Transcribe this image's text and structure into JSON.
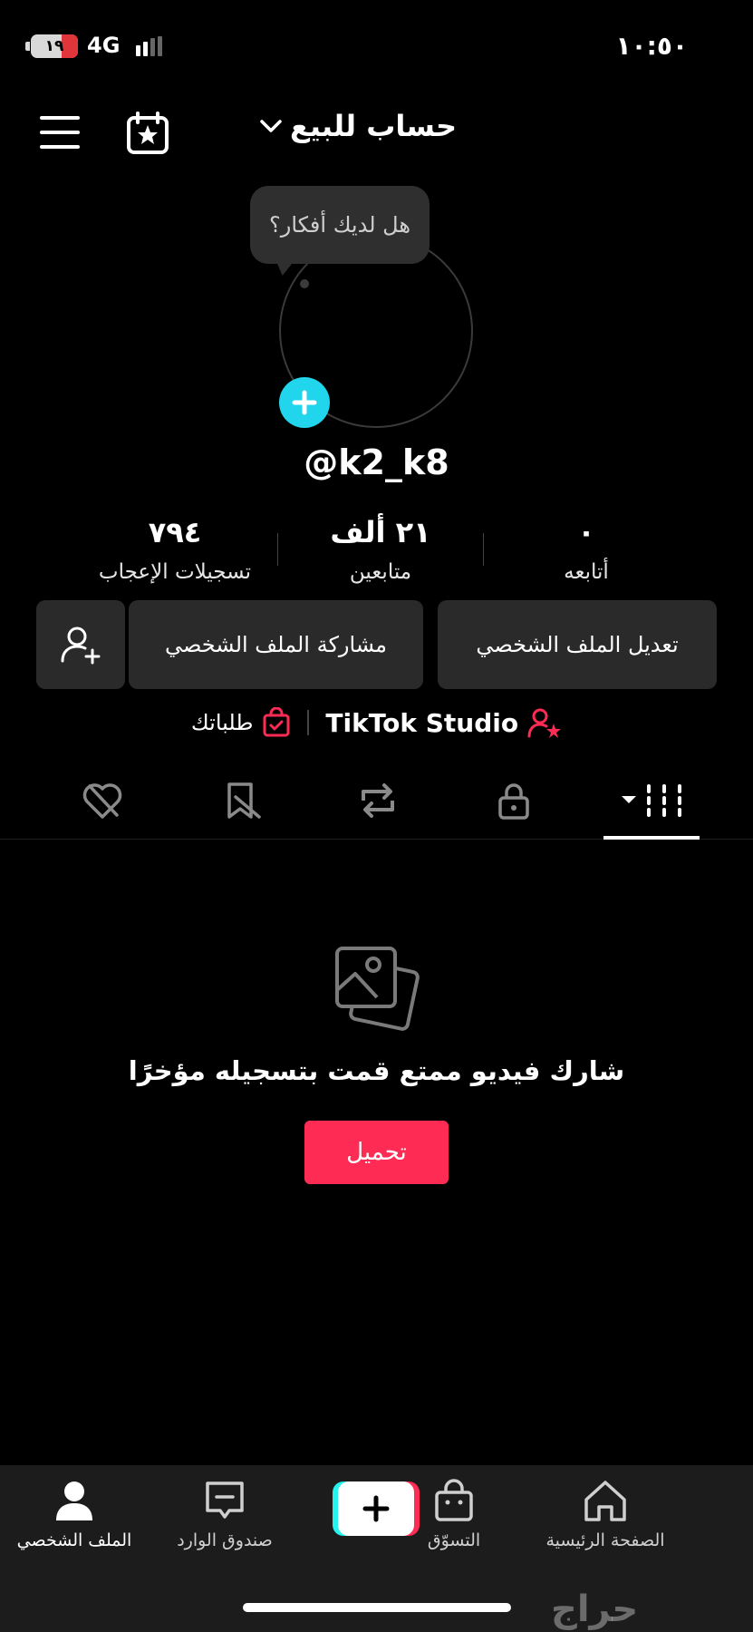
{
  "status_bar": {
    "time": "١٠:٥٠",
    "battery_level": "١٩",
    "network": "4G"
  },
  "header": {
    "account_name": "حساب للبيع"
  },
  "avatar": {
    "bubble_text": "هل لديك أفكار؟"
  },
  "profile": {
    "username": "@k2_k8",
    "stats": {
      "following": {
        "value": "٠",
        "label": "أتابعه"
      },
      "followers": {
        "value": "٢١ ألف",
        "label": "متابعين"
      },
      "likes": {
        "value": "٧٩٤",
        "label": "تسجيلات الإعجاب"
      }
    }
  },
  "actions": {
    "edit_label": "تعديل الملف الشخصي",
    "share_label": "مشاركة الملف الشخصي"
  },
  "links": {
    "studio_label": "TikTok Studio",
    "orders_label": "طلباتك"
  },
  "empty_state": {
    "message": "شارك فيديو ممتع قمت بتسجيله مؤخرًا",
    "upload_label": "تحميل"
  },
  "bottom_nav": {
    "home": "الصفحة الرئيسية",
    "shop": "التسوّق",
    "inbox": "صندوق الوارد",
    "profile": "الملف الشخصي"
  },
  "watermark": "حراج",
  "colors": {
    "accent_red": "#fe2c55",
    "accent_cyan": "#20d5ec",
    "button_bg": "#2a2a2a"
  }
}
